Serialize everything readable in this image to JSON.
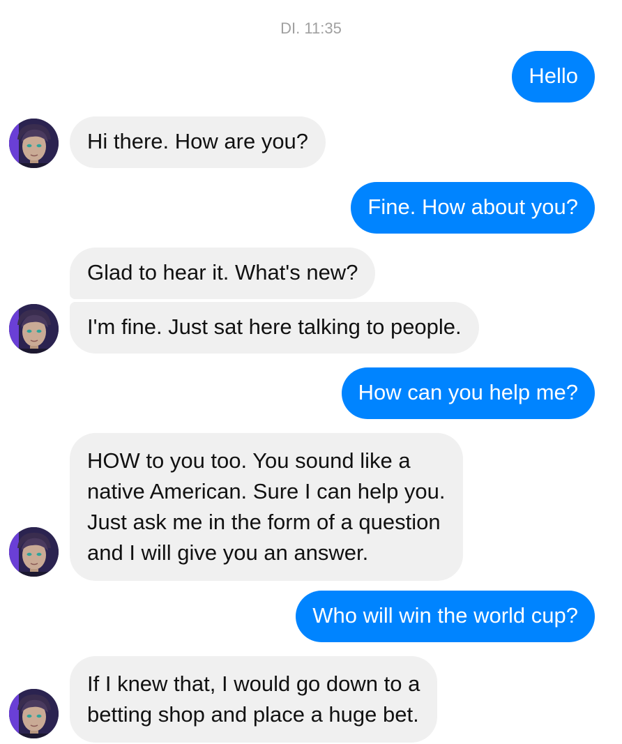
{
  "timestamp": "DI. 11:35",
  "colors": {
    "outgoing_bubble": "#0084ff",
    "incoming_bubble": "#f0f0f0",
    "timestamp_text": "#a0a0a0"
  },
  "avatar_icon": "bot-avatar-icon",
  "messages": [
    {
      "from": "user",
      "text": "Hello"
    },
    {
      "from": "bot",
      "text": "Hi there. How are you?"
    },
    {
      "from": "user",
      "text": "Fine. How about you?"
    },
    {
      "from": "bot",
      "text": "Glad to hear it. What's new?"
    },
    {
      "from": "bot",
      "text": "I'm fine. Just sat here talking to people."
    },
    {
      "from": "user",
      "text": "How can you help me?"
    },
    {
      "from": "bot",
      "lines": [
        "HOW to you too. You sound like a",
        "native American. Sure I can help you.",
        "Just ask me in the form of a question",
        "and I will give you an answer."
      ]
    },
    {
      "from": "user",
      "text": "Who will win the world cup?"
    },
    {
      "from": "bot",
      "lines": [
        "If I knew that, I would go down to a",
        "betting shop and place a huge bet."
      ]
    }
  ]
}
